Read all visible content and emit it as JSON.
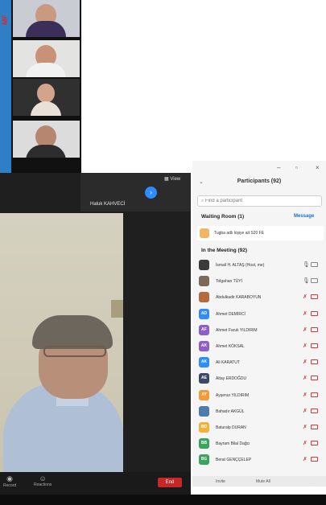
{
  "brand_strip": {
    "text": "MF",
    "color": "#2f7fc6"
  },
  "video": {
    "speaker_name": "Haluk KAHVECİ",
    "view_label": "View",
    "controls": [
      {
        "label": "Record",
        "icon": "record-icon"
      },
      {
        "label": "Reactions",
        "icon": "reactions-icon"
      }
    ],
    "end_label": "End"
  },
  "panel": {
    "title": "Participants (92)",
    "search_placeholder": "Find a participant",
    "waiting_room": {
      "title": "Waiting Room (1)",
      "message_label": "Message",
      "entry": "Tugba adlı kişiye ait S20 FE"
    },
    "in_meeting_title": "In the Meeting (92)",
    "participants": [
      {
        "name": "İsmail H. ALTAŞ (Host, me)",
        "initials": "",
        "color": "#3b3b3b",
        "mic_on": true,
        "cam_on": true
      },
      {
        "name": "Tolgahan TÜYİ",
        "initials": "",
        "color": "#7a6a5a",
        "mic_on": true,
        "cam_on": true
      },
      {
        "name": "Abdulkadir KARABOYUN",
        "initials": "",
        "color": "#b56a3e",
        "mic_on": false,
        "cam_on": false
      },
      {
        "name": "Ahmet DEMİRCİ",
        "initials": "AD",
        "color": "#2d8cff",
        "mic_on": false,
        "cam_on": false
      },
      {
        "name": "Ahmet Faruk YILDIRIM",
        "initials": "AF",
        "color": "#8e5fc9",
        "mic_on": false,
        "cam_on": false
      },
      {
        "name": "Ahmet KÖKSAL",
        "initials": "AK",
        "color": "#8e5fc9",
        "mic_on": false,
        "cam_on": false
      },
      {
        "name": "Ali KARATUT",
        "initials": "AK",
        "color": "#2d8cff",
        "mic_on": false,
        "cam_on": false
      },
      {
        "name": "Altay ERDOĞDU",
        "initials": "AE",
        "color": "#3a4a64",
        "mic_on": false,
        "cam_on": false
      },
      {
        "name": "Ayşenur YILDIRIM",
        "initials": "AY",
        "color": "#f29b38",
        "mic_on": false,
        "cam_on": false
      },
      {
        "name": "Bahadır AKGÜL",
        "initials": "",
        "color": "#4f7dab",
        "mic_on": false,
        "cam_on": false
      },
      {
        "name": "Baturalp DURAN",
        "initials": "BD",
        "color": "#f2b23a",
        "mic_on": false,
        "cam_on": false
      },
      {
        "name": "Bayram Bilal Dağcı",
        "initials": "BB",
        "color": "#3aa35d",
        "mic_on": false,
        "cam_on": false
      },
      {
        "name": "Berat GENÇÇELEP",
        "initials": "BG",
        "color": "#3aa35d",
        "mic_on": false,
        "cam_on": false
      }
    ],
    "footer": {
      "invite_label": "Invite",
      "mute_all_label": "Mute All"
    }
  }
}
